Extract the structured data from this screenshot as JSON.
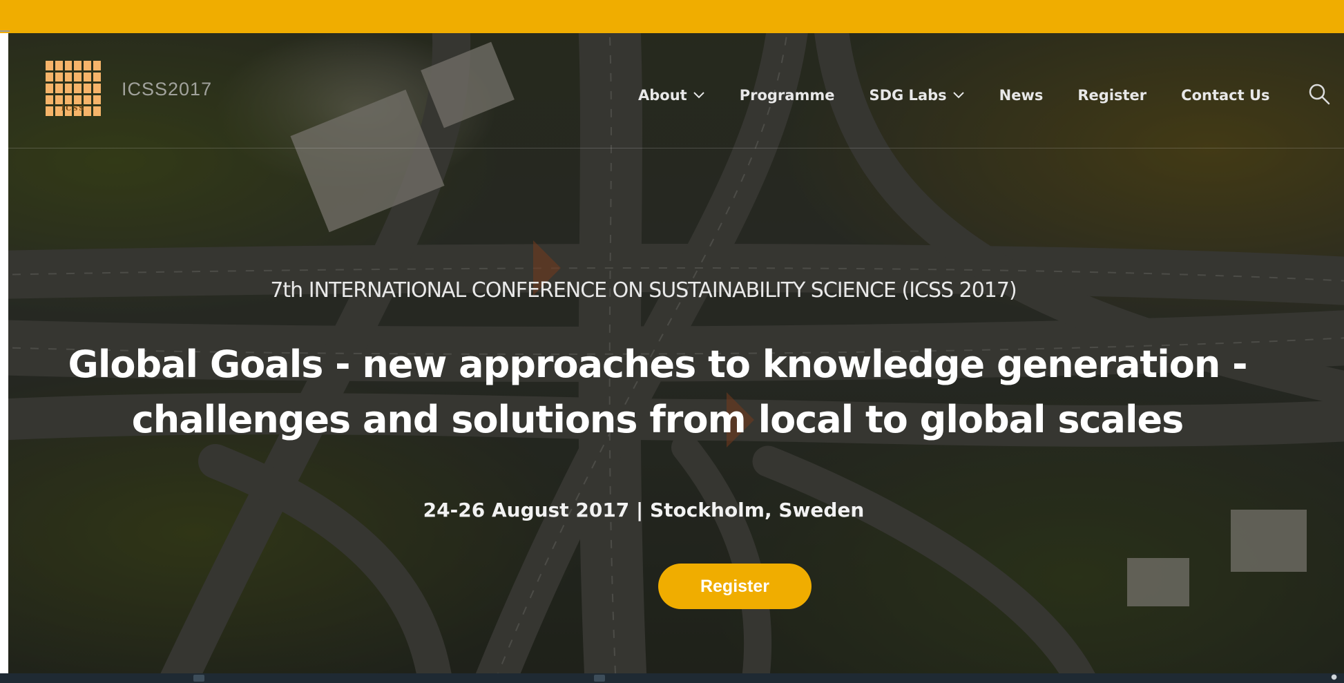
{
  "brand": {
    "site_name": "ICSS2017",
    "logo_text": "ICSS"
  },
  "nav": {
    "items": [
      {
        "label": "About",
        "has_dropdown": true
      },
      {
        "label": "Programme",
        "has_dropdown": false
      },
      {
        "label": "SDG Labs",
        "has_dropdown": true
      },
      {
        "label": "News",
        "has_dropdown": false
      },
      {
        "label": "Register",
        "has_dropdown": false
      },
      {
        "label": "Contact Us",
        "has_dropdown": false
      }
    ],
    "search_icon": "search-icon"
  },
  "hero": {
    "kicker": "7th INTERNATIONAL CONFERENCE ON SUSTAINABILITY SCIENCE (ICSS 2017)",
    "headline_line1": "Global Goals - new approaches to knowledge generation -",
    "headline_line2": "challenges and solutions from local to global scales",
    "date_location": "24-26 August 2017 | Stockholm, Sweden",
    "cta_label": "Register"
  },
  "colors": {
    "accent": "#f0ad00",
    "nav_text": "#e8e8e8",
    "logo": "#f6b46a"
  }
}
